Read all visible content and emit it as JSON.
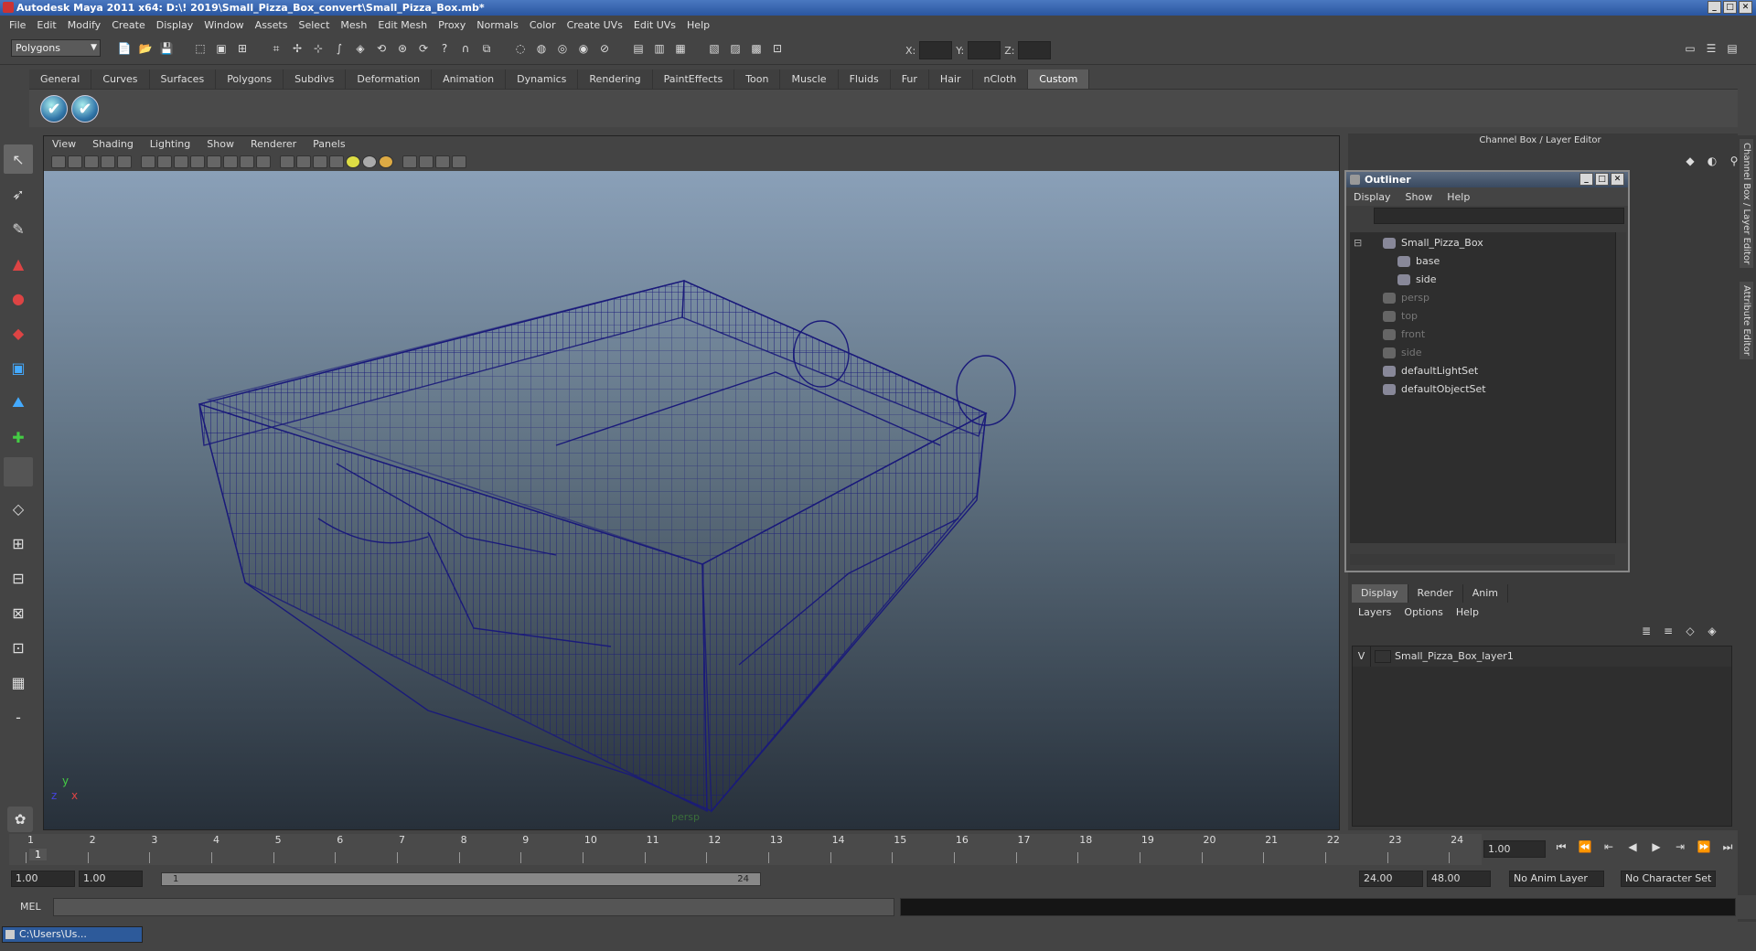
{
  "window": {
    "title": "Autodesk Maya 2011 x64: D:\\! 2019\\Small_Pizza_Box_convert\\Small_Pizza_Box.mb*"
  },
  "menubar": [
    "File",
    "Edit",
    "Modify",
    "Create",
    "Display",
    "Window",
    "Assets",
    "Select",
    "Mesh",
    "Edit Mesh",
    "Proxy",
    "Normals",
    "Color",
    "Create UVs",
    "Edit UVs",
    "Help"
  ],
  "statusline": {
    "mode": "Polygons",
    "x_label": "X:",
    "y_label": "Y:",
    "z_label": "Z:"
  },
  "shelf_tabs": [
    "General",
    "Curves",
    "Surfaces",
    "Polygons",
    "Subdivs",
    "Deformation",
    "Animation",
    "Dynamics",
    "Rendering",
    "PaintEffects",
    "Toon",
    "Muscle",
    "Fluids",
    "Fur",
    "Hair",
    "nCloth",
    "Custom"
  ],
  "shelf_active": "Custom",
  "viewport": {
    "menu": [
      "View",
      "Shading",
      "Lighting",
      "Show",
      "Renderer",
      "Panels"
    ],
    "camera": "persp",
    "axis_y": "y",
    "axis_x": "x",
    "axis_z": "z"
  },
  "channel_box": {
    "title": "Channel Box / Layer Editor"
  },
  "outliner": {
    "title": "Outliner",
    "menu": [
      "Display",
      "Show",
      "Help"
    ],
    "items": [
      {
        "label": "Small_Pizza_Box",
        "dim": false,
        "indent": 0
      },
      {
        "label": "base",
        "dim": false,
        "indent": 1
      },
      {
        "label": "side",
        "dim": false,
        "indent": 1
      },
      {
        "label": "persp",
        "dim": true,
        "indent": 0
      },
      {
        "label": "top",
        "dim": true,
        "indent": 0
      },
      {
        "label": "front",
        "dim": true,
        "indent": 0
      },
      {
        "label": "side",
        "dim": true,
        "indent": 0
      },
      {
        "label": "defaultLightSet",
        "dim": false,
        "indent": 0
      },
      {
        "label": "defaultObjectSet",
        "dim": false,
        "indent": 0
      }
    ]
  },
  "layer_editor": {
    "tabs": [
      "Display",
      "Render",
      "Anim"
    ],
    "active_tab": "Display",
    "menu": [
      "Layers",
      "Options",
      "Help"
    ],
    "layers": [
      {
        "visible": "V",
        "name": "Small_Pizza_Box_layer1"
      }
    ]
  },
  "timeline": {
    "ticks": [
      "1",
      "2",
      "3",
      "4",
      "5",
      "6",
      "7",
      "8",
      "9",
      "10",
      "11",
      "12",
      "13",
      "14",
      "15",
      "16",
      "17",
      "18",
      "19",
      "20",
      "21",
      "22",
      "23",
      "24"
    ],
    "current_frame_marker": "1",
    "current_time": "1.00"
  },
  "range": {
    "start": "1.00",
    "playback_start": "1.00",
    "slider_start": "1",
    "slider_end": "24",
    "playback_end": "24.00",
    "end": "48.00",
    "anim_layer": "No Anim Layer",
    "character_set": "No Character Set"
  },
  "command_line": {
    "label": "MEL"
  },
  "taskbar": {
    "item": "C:\\Users\\Us..."
  },
  "side_tabs": [
    "Channel Box / Layer Editor",
    "Attribute Editor"
  ],
  "colors": {
    "wireframe": "#1a1a7a",
    "accent": "#2a56a0"
  }
}
